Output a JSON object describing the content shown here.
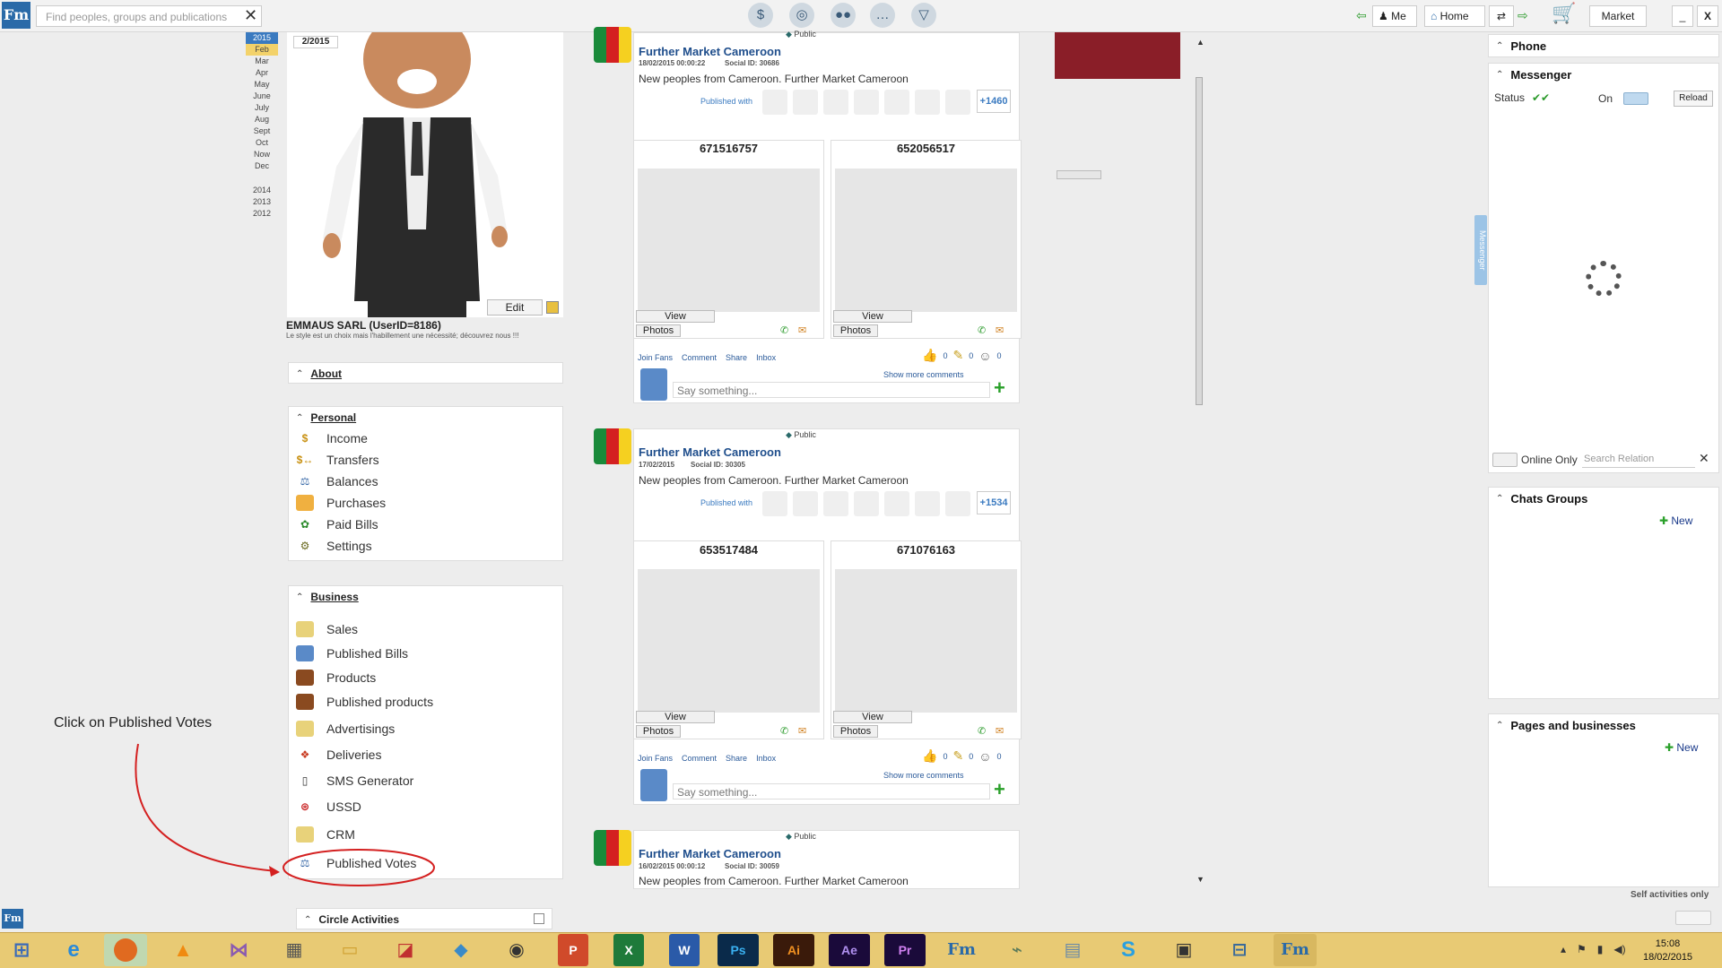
{
  "topbar": {
    "logo": "Fm",
    "search_placeholder": "Find peoples, groups and publications",
    "clear": "✕",
    "me_label": "Me",
    "home_label": "Home",
    "market_label": "Market",
    "minimize": "_",
    "close": "X"
  },
  "calendar": {
    "year_current": "2015",
    "months": [
      "Feb",
      "Mar",
      "Apr",
      "May",
      "June",
      "July",
      "Aug",
      "Sept",
      "Oct",
      "Now",
      "Dec"
    ],
    "years": [
      "2014",
      "2013",
      "2012"
    ]
  },
  "profile": {
    "date": "2/2015",
    "edit_label": "Edit",
    "name": "EMMAUS SARL (UserID=8186)",
    "slogan": "Le style est un choix mais l'habillement une nécessité; découvrez nous !!!"
  },
  "about": {
    "title": "About"
  },
  "personal": {
    "title": "Personal",
    "items": [
      "Income",
      "Transfers",
      "Balances",
      "Purchases",
      "Paid Bills",
      "Settings"
    ]
  },
  "business": {
    "title": "Business",
    "items": [
      "Sales",
      "Published Bills",
      "Products",
      "Published products",
      "Advertisings",
      "Deliveries",
      "SMS Generator",
      "USSD",
      "CRM",
      "Published Votes"
    ]
  },
  "circle": {
    "title": "Circle Activities"
  },
  "annotation": {
    "text": "Click on Published Votes"
  },
  "posts": [
    {
      "visibility": "Public",
      "title": "Further Market Cameroon",
      "date": "18/02/2015 00:00:22",
      "social_id": "Social ID: 30686",
      "text": "New peoples from Cameroon. Further Market Cameroon",
      "published_with": "Published with",
      "more_count": "+1460",
      "photos": [
        {
          "id": "671516757"
        },
        {
          "id": "652056517"
        }
      ],
      "view_label": "View",
      "photos_label": "Photos",
      "actions": [
        "Join Fans",
        "Comment",
        "Share",
        "Inbox"
      ],
      "counts": [
        "0",
        "0",
        "0"
      ],
      "show_more": "Show more comments",
      "say_placeholder": "Say something..."
    },
    {
      "visibility": "Public",
      "title": "Further Market Cameroon",
      "date": "17/02/2015",
      "social_id": "Social ID: 30305",
      "text": "New peoples from Cameroon. Further Market Cameroon",
      "published_with": "Published with",
      "more_count": "+1534",
      "photos": [
        {
          "id": "653517484"
        },
        {
          "id": "671076163"
        }
      ],
      "view_label": "View",
      "photos_label": "Photos",
      "actions": [
        "Join Fans",
        "Comment",
        "Share",
        "Inbox"
      ],
      "counts": [
        "0",
        "0",
        "0"
      ],
      "show_more": "Show more comments",
      "say_placeholder": "Say something..."
    },
    {
      "visibility": "Public",
      "title": "Further Market Cameroon",
      "date": "16/02/2015 00:00:12",
      "social_id": "Social ID: 30059",
      "text": "New peoples from Cameroon. Further Market Cameroon"
    }
  ],
  "right": {
    "phone_title": "Phone",
    "messenger_title": "Messenger",
    "status_label": "Status",
    "on_label": "On",
    "reload_label": "Reload",
    "side_tab": "Messenger",
    "online_only": "Online Only",
    "search_relation_placeholder": "Search Relation",
    "chats_title": "Chats Groups",
    "chats_new": "New",
    "pages_title": "Pages and businesses",
    "pages_new": "New",
    "self_activities": "Self activities only"
  },
  "taskbar": {
    "time": "15:08",
    "date": "18/02/2015",
    "apps": [
      "Ps",
      "Ai",
      "Ae",
      "Pr",
      "Fm"
    ]
  },
  "colors": {
    "link_blue": "#1f4e8c",
    "annotation_red": "#d42020",
    "taskbar": "#e8ca74"
  }
}
